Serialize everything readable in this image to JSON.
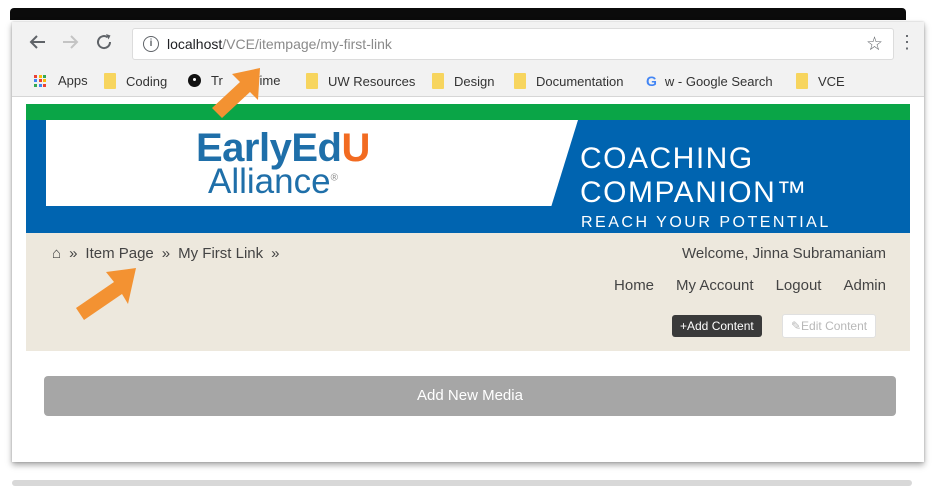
{
  "browser": {
    "url_host": "localhost",
    "url_path": "/VCE/itempage/my-first-link",
    "back_icon": "arrow-left",
    "forward_icon": "arrow-right",
    "reload_icon": "reload",
    "info_icon": "info",
    "star_icon": "star",
    "menu_icon": "vertical-dots"
  },
  "bookmarks": [
    {
      "label": "Apps",
      "icon": "apps-grid"
    },
    {
      "label": "Coding",
      "icon": "folder"
    },
    {
      "label": "Tr",
      "label_tail": "gTime",
      "icon": "clock"
    },
    {
      "label": "UW Resources",
      "icon": "folder"
    },
    {
      "label": "Design",
      "icon": "folder"
    },
    {
      "label": "Documentation",
      "icon": "folder"
    },
    {
      "label": "w - Google Search",
      "icon": "google-g"
    },
    {
      "label": "VCE",
      "icon": "folder"
    }
  ],
  "site": {
    "logo_line1_a": "EarlyEd",
    "logo_line1_b": "U",
    "logo_line2": "Alliance",
    "logo_reg": "®",
    "tagline_1": "COACHING",
    "tagline_2": "COMPANION™",
    "tagline_3": "REACH YOUR POTENTIAL",
    "colors": {
      "green": "#0aa547",
      "blue": "#0064b0",
      "panel": "#ede8dd"
    }
  },
  "breadcrumb": {
    "home_icon": "⌂",
    "separator": "»",
    "items": [
      "Item Page",
      "My First Link"
    ]
  },
  "user": {
    "welcome": "Welcome, Jinna Subramaniam"
  },
  "nav": [
    "Home",
    "My Account",
    "Logout",
    "Admin"
  ],
  "actions": {
    "add_content": "+Add Content",
    "edit_content": "✎Edit Content",
    "add_media": "Add New Media"
  },
  "annotation_color": "#f39232"
}
